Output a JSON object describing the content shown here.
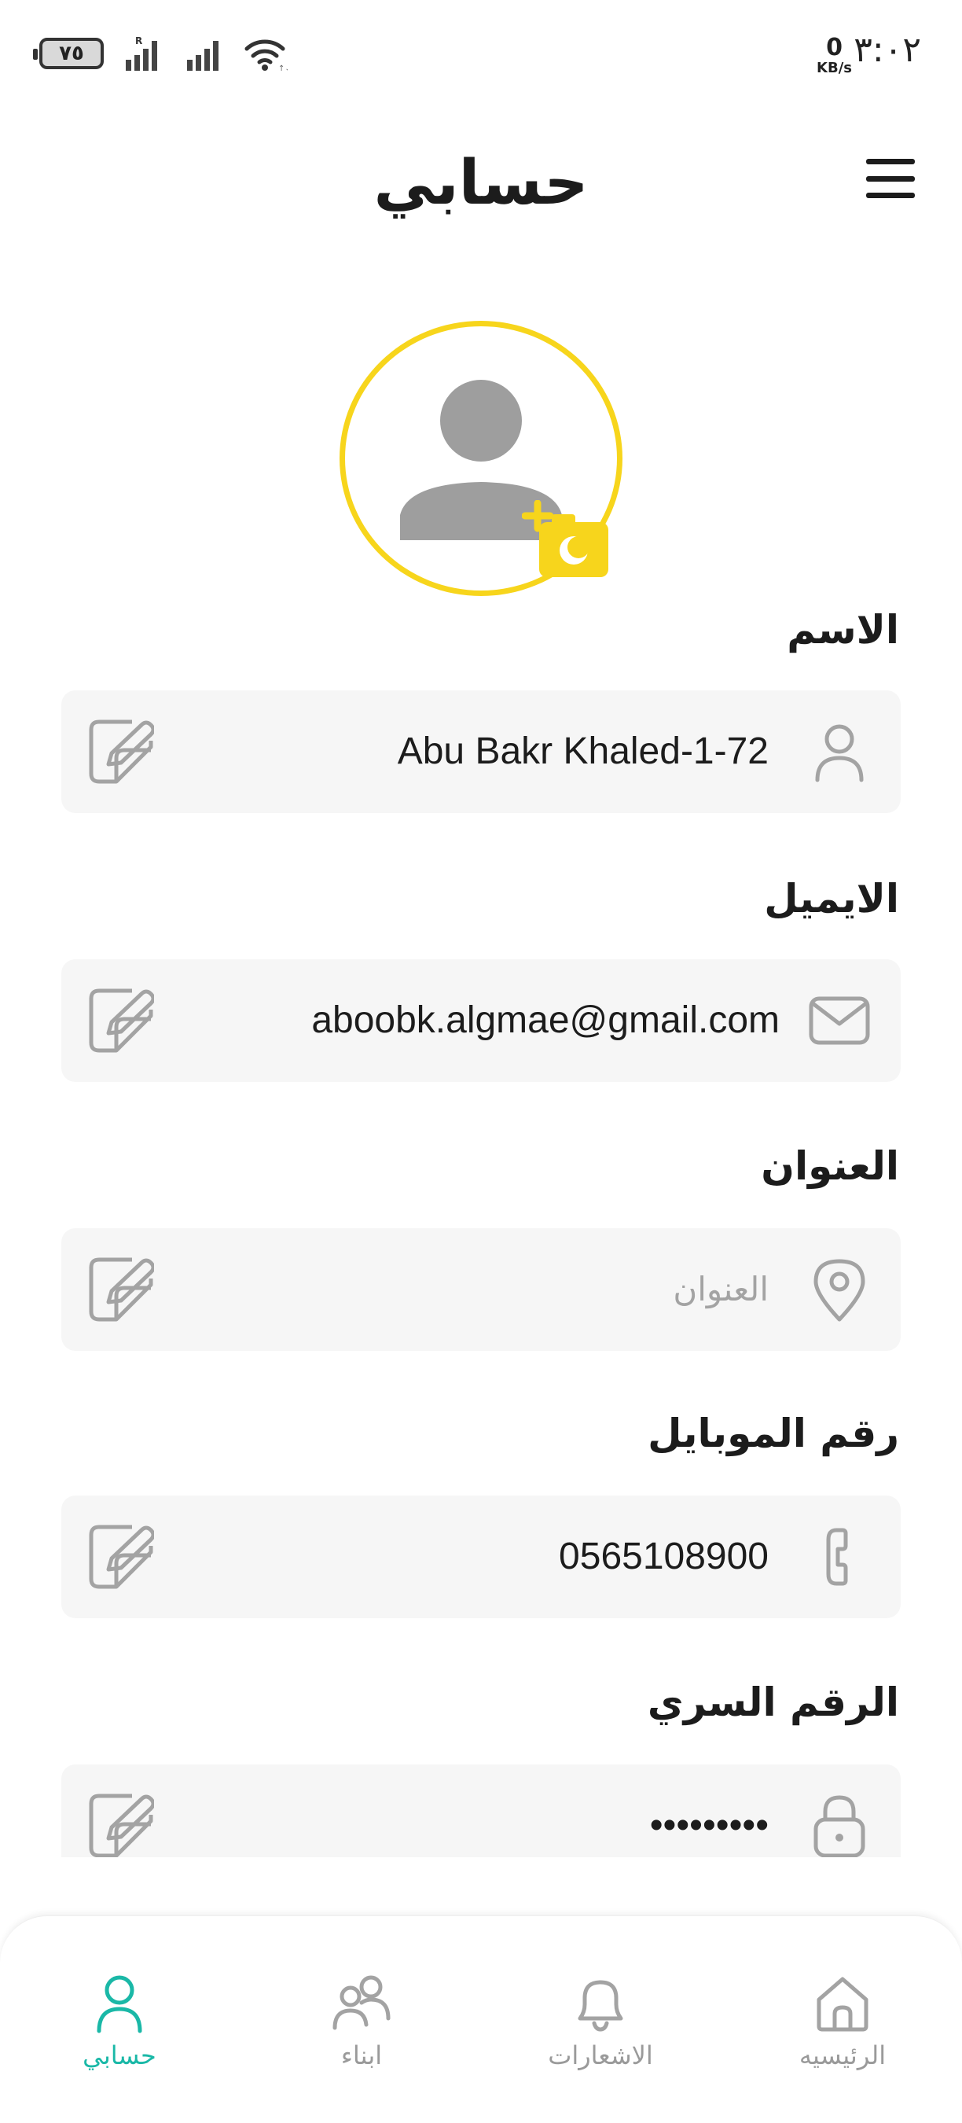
{
  "status_bar": {
    "time": "٣:٠٢",
    "speed_value": "0",
    "speed_unit": "KB/s",
    "battery": "٧٥"
  },
  "header": {
    "title": "حسابي",
    "menu_icon": "hamburger-menu-icon"
  },
  "avatar": {
    "icon": "user-placeholder-icon",
    "badge_icon": "add-photo-camera-icon",
    "ring_color": "#f7d51c"
  },
  "fields": {
    "name": {
      "label": "الاسم",
      "value": "Abu Bakr Khaled-1-72",
      "icon": "person-icon"
    },
    "email": {
      "label": "الايميل",
      "value": "aboobk.algmae@gmail.com",
      "icon": "mail-icon"
    },
    "address": {
      "label": "العنوان",
      "placeholder": "العنوان",
      "icon": "location-pin-icon"
    },
    "mobile": {
      "label": "رقم الموبايل",
      "value": "0565108900",
      "icon": "phone-icon"
    },
    "password": {
      "label": "الرقم السري",
      "value": "•••••••••",
      "icon": "lock-icon"
    }
  },
  "bottom_nav": {
    "items": [
      {
        "label": "حسابي",
        "icon": "profile-icon",
        "active": true
      },
      {
        "label": "ابناء",
        "icon": "children-icon",
        "active": false
      },
      {
        "label": "الاشعارات",
        "icon": "bell-icon",
        "active": false
      },
      {
        "label": "الرئيسيه",
        "icon": "home-icon",
        "active": false
      }
    ]
  },
  "colors": {
    "accent": "#1ab8a7",
    "avatar_ring": "#f7d51c",
    "field_bg": "#f6f6f6",
    "icon_gray": "#a3a3a3"
  }
}
